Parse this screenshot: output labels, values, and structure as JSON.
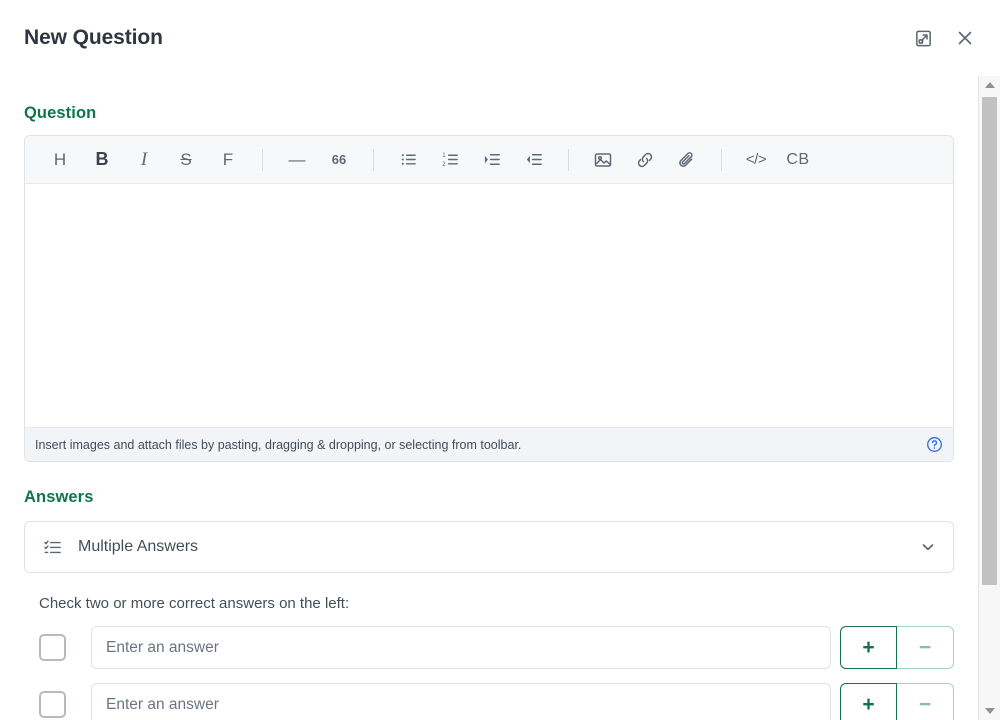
{
  "header": {
    "title": "New Question",
    "expand_icon": "expand-icon",
    "close_icon": "close-icon"
  },
  "question": {
    "label": "Question",
    "toolbar": [
      {
        "id": "heading",
        "label": "H",
        "icon": "heading-icon"
      },
      {
        "id": "bold",
        "label": "B",
        "icon": "bold-icon"
      },
      {
        "id": "italic",
        "label": "I",
        "icon": "italic-icon"
      },
      {
        "id": "strikethrough",
        "label": "S",
        "icon": "strikethrough-icon"
      },
      {
        "id": "font",
        "label": "F",
        "icon": "font-icon"
      },
      {
        "id": "separator-1",
        "label": "",
        "icon": "separator"
      },
      {
        "id": "horizontal-rule",
        "label": "—",
        "icon": "horizontal-rule-icon"
      },
      {
        "id": "blockquote",
        "label": "66",
        "icon": "blockquote-icon"
      },
      {
        "id": "separator-2",
        "label": "",
        "icon": "separator"
      },
      {
        "id": "bulleted-list",
        "label": "",
        "icon": "bulleted-list-icon"
      },
      {
        "id": "numbered-list",
        "label": "",
        "icon": "numbered-list-icon"
      },
      {
        "id": "indent-increase",
        "label": "",
        "icon": "indent-increase-icon"
      },
      {
        "id": "indent-decrease",
        "label": "",
        "icon": "indent-decrease-icon"
      },
      {
        "id": "separator-3",
        "label": "",
        "icon": "separator"
      },
      {
        "id": "image",
        "label": "",
        "icon": "image-icon"
      },
      {
        "id": "link",
        "label": "",
        "icon": "link-icon"
      },
      {
        "id": "attachment",
        "label": "",
        "icon": "paperclip-icon"
      },
      {
        "id": "separator-4",
        "label": "",
        "icon": "separator"
      },
      {
        "id": "inline-code",
        "label": "</>",
        "icon": "code-icon"
      },
      {
        "id": "code-block",
        "label": "CB",
        "icon": "code-block-icon"
      }
    ],
    "editor_value": "",
    "editor_placeholder": "",
    "footer_hint": "Insert images and attach files by pasting, dragging & dropping, or selecting from toolbar.",
    "help_icon": "help-circle-icon"
  },
  "answers": {
    "label": "Answers",
    "type_select": {
      "value": "Multiple Answers",
      "icon": "checklist-icon",
      "chevron": "chevron-down-icon"
    },
    "instruction": "Check two or more correct answers on the left:",
    "add_label": "+",
    "remove_label": "−",
    "rows": [
      {
        "checked": false,
        "value": "",
        "placeholder": "Enter an answer"
      },
      {
        "checked": false,
        "value": "",
        "placeholder": "Enter an answer"
      }
    ]
  },
  "colors": {
    "accent_green": "#11754c",
    "button_green": "#14724e",
    "button_green_disabled": "#85bfa7",
    "help_blue": "#2f6fe0",
    "text_primary": "#30363f"
  }
}
